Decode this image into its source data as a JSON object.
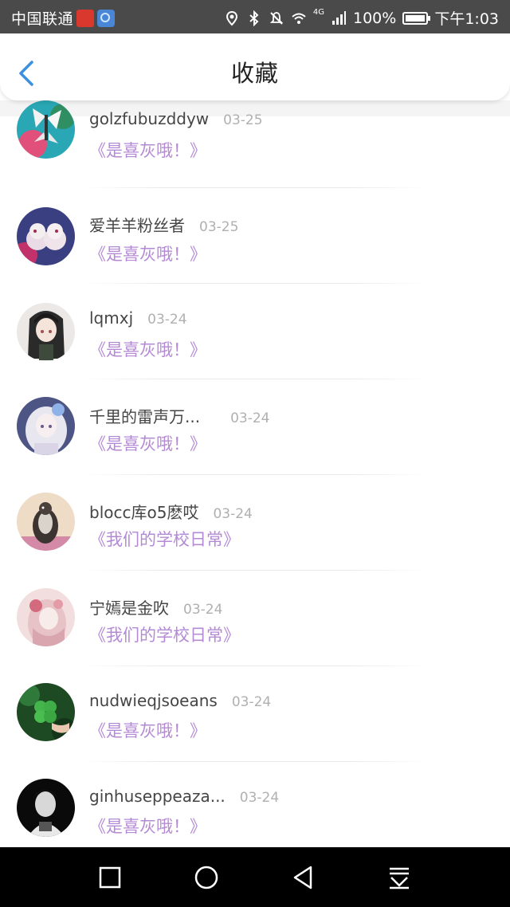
{
  "status_bar": {
    "carrier": "中国联通",
    "battery": "100%",
    "network": "4G",
    "time": "下午1:03"
  },
  "header": {
    "title": "收藏",
    "back_icon": "chevron-left-icon"
  },
  "items": [
    {
      "name": "golzfubuzddyw",
      "date": "03-25",
      "book": "《是喜灰哦！》"
    },
    {
      "name": "爱羊羊粉丝者",
      "date": "03-25",
      "book": "《是喜灰哦！》"
    },
    {
      "name": "lqmxj",
      "date": "03-24",
      "book": "《是喜灰哦！》"
    },
    {
      "name": "千里的雷声万...",
      "date": "03-24",
      "book": "《是喜灰哦！》"
    },
    {
      "name": "blocc库o5麽哎",
      "date": "03-24",
      "book": "《我们的学校日常》"
    },
    {
      "name": "宁嫣是金吹",
      "date": "03-24",
      "book": "《我们的学校日常》"
    },
    {
      "name": "nudwieqjsoeans",
      "date": "03-24",
      "book": "《是喜灰哦！》"
    },
    {
      "name": "ginhuseppeaza...",
      "date": "03-24",
      "book": "《是喜灰哦！》"
    }
  ],
  "colors": {
    "accent": "#3b8fe0",
    "book_title": "#b48ad6",
    "status_bar": "#4a4a4a",
    "nav_bar": "#000000"
  },
  "nav_bar": [
    "square-icon",
    "circle-home-icon",
    "triangle-back-icon",
    "download-icon"
  ]
}
